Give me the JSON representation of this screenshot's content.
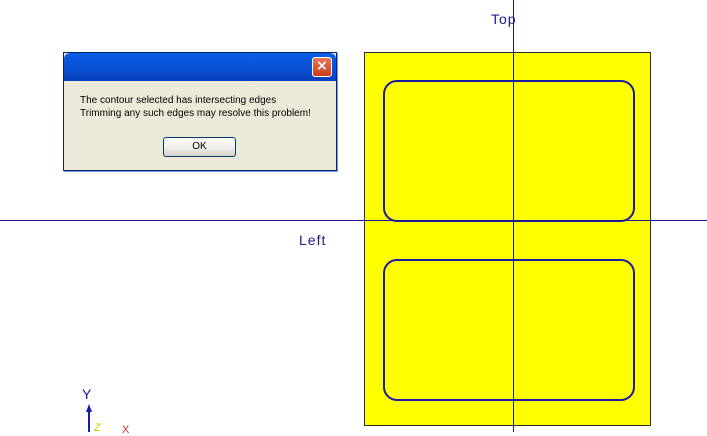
{
  "viewport": {
    "top_label": "Top",
    "left_label": "Left",
    "ucs": {
      "y_label": "Y",
      "z_label": "Z",
      "x_label": "X"
    }
  },
  "dialog": {
    "close_glyph": "×",
    "message_line_1": "The contour selected has intersecting edges",
    "message_line_2": "Trimming any such edges may resolve this problem!",
    "ok_label": "OK"
  },
  "colors": {
    "sheet_fill": "#ffff00",
    "contour_stroke": "#1a1aa6",
    "axis_line": "#1a1a8c",
    "titlebar": "#0a53d8"
  }
}
